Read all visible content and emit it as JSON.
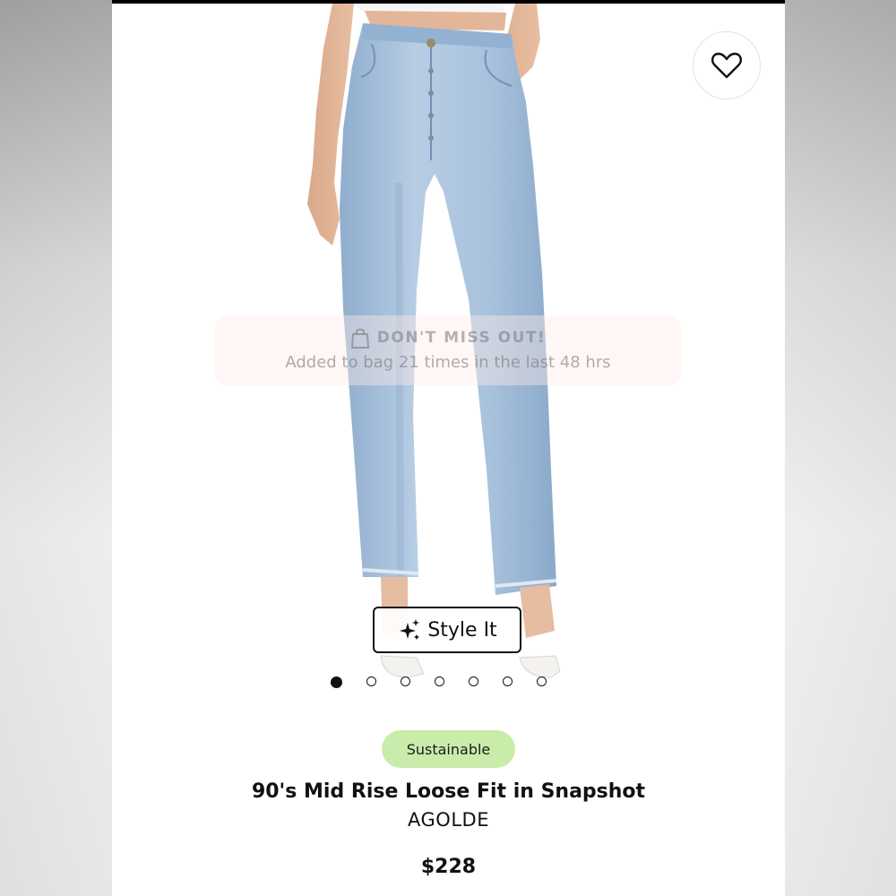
{
  "product_image": {
    "description_icon": "jeans-photo",
    "favorite_icon": "heart-outline-icon"
  },
  "banner": {
    "title": "DON'T MISS OUT!",
    "subtitle": "Added to bag 21 times in the last 48 hrs",
    "icon": "shopping-bag-icon"
  },
  "style_it": {
    "label": "Style It",
    "icon": "sparkles-icon"
  },
  "carousel": {
    "total": 7,
    "active_index": 0
  },
  "product": {
    "badge": "Sustainable",
    "title": "90's Mid Rise Loose Fit in Snapshot",
    "brand": "AGOLDE",
    "price": "$228"
  },
  "colors": {
    "badge_bg": "#c9ecaa",
    "denim": "#a9c3de",
    "text": "#111111"
  }
}
